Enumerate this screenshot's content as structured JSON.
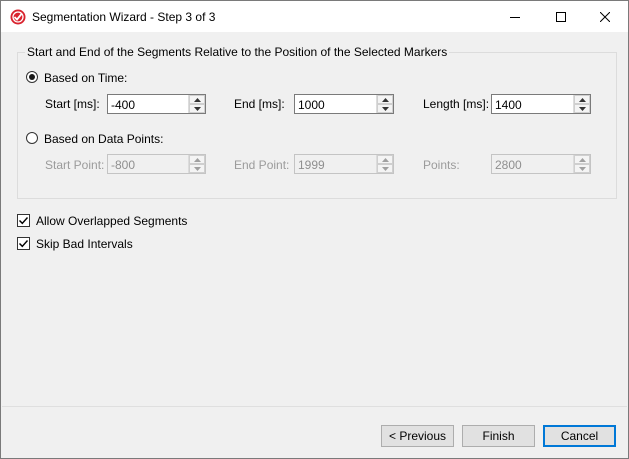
{
  "window": {
    "title": "Segmentation Wizard - Step 3 of 3"
  },
  "group": {
    "label": "Start and End of the Segments Relative to the Position of the Selected Markers",
    "time": {
      "option_label": "Based on Time:",
      "selected": true,
      "start_label": "Start [ms]:",
      "start_value": "-400",
      "end_label": "End [ms]:",
      "end_value": "1000",
      "length_label": "Length [ms]:",
      "length_value": "1400"
    },
    "points": {
      "option_label": "Based on Data Points:",
      "selected": false,
      "start_label": "Start Point:",
      "start_value": "-800",
      "end_label": "End Point:",
      "end_value": "1999",
      "points_label": "Points:",
      "points_value": "2800"
    }
  },
  "options": {
    "allow_overlapped": {
      "label": "Allow Overlapped Segments",
      "checked": true
    },
    "skip_bad": {
      "label": "Skip Bad Intervals",
      "checked": true
    }
  },
  "buttons": {
    "previous": "< Previous",
    "finish": "Finish",
    "cancel": "Cancel"
  },
  "icons": {
    "app": "app-logo-icon",
    "minimize": "minimize-icon",
    "maximize": "maximize-icon",
    "close": "close-icon",
    "spin_up": "chevron-up-icon",
    "spin_down": "chevron-down-icon",
    "check": "checkmark-icon"
  },
  "colors": {
    "app_icon": "#d9232e",
    "default_button_border": "#0078d7"
  }
}
